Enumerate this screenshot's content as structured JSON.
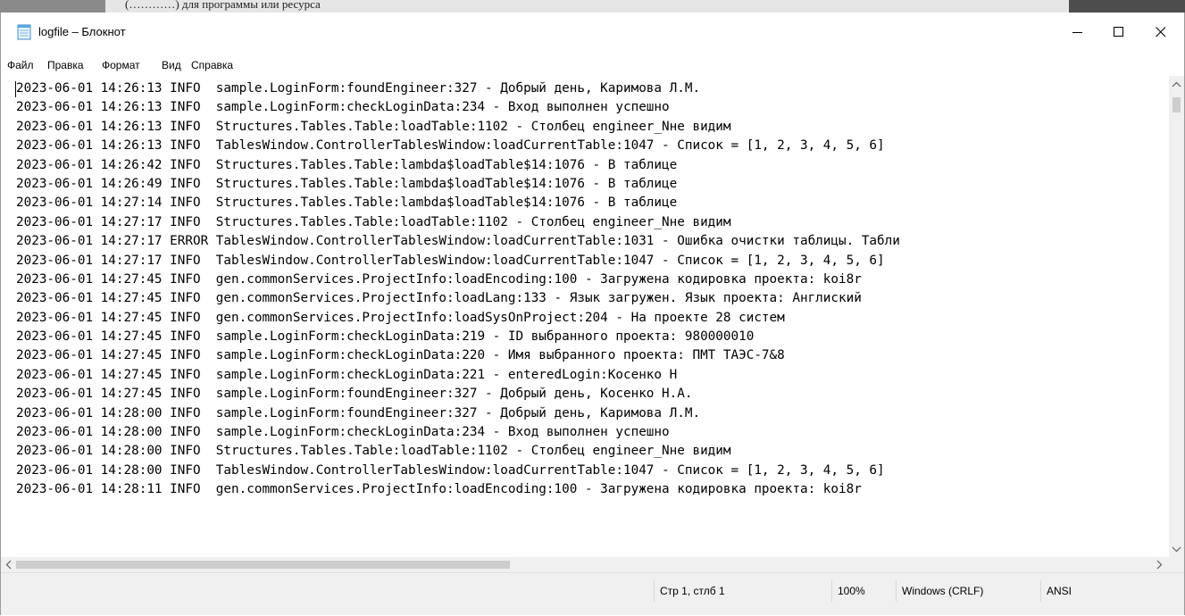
{
  "backdrop": {
    "text": "(…………) для программы или ресурса"
  },
  "window": {
    "title": "logfile – Блокнот",
    "buttons": {
      "minimize": "minimize",
      "maximize": "maximize",
      "close": "close"
    }
  },
  "menu": {
    "items": [
      "Файл",
      "Правка",
      "Формат",
      "Вид",
      "Справка"
    ]
  },
  "editor": {
    "lines": [
      "2023-06-01 14:26:13 INFO  sample.LoginForm:foundEngineer:327 - Добрый день, Каримова Л.М.",
      "2023-06-01 14:26:13 INFO  sample.LoginForm:checkLoginData:234 - Вход выполнен успешно",
      "2023-06-01 14:26:13 INFO  Structures.Tables.Table:loadTable:1102 - Столбец engineer_Nне видим",
      "2023-06-01 14:26:13 INFO  TablesWindow.ControllerTablesWindow:loadCurrentTable:1047 - Список = [1, 2, 3, 4, 5, 6]",
      "2023-06-01 14:26:42 INFO  Structures.Tables.Table:lambda$loadTable$14:1076 - В таблице",
      "2023-06-01 14:26:49 INFO  Structures.Tables.Table:lambda$loadTable$14:1076 - В таблице",
      "2023-06-01 14:27:14 INFO  Structures.Tables.Table:lambda$loadTable$14:1076 - В таблице",
      "2023-06-01 14:27:17 INFO  Structures.Tables.Table:loadTable:1102 - Столбец engineer_Nне видим",
      "2023-06-01 14:27:17 ERROR TablesWindow.ControllerTablesWindow:loadCurrentTable:1031 - Ошибка очистки таблицы. Табли",
      "2023-06-01 14:27:17 INFO  TablesWindow.ControllerTablesWindow:loadCurrentTable:1047 - Список = [1, 2, 3, 4, 5, 6]",
      "2023-06-01 14:27:45 INFO  gen.commonServices.ProjectInfo:loadEncoding:100 - Загружена кодировка проекта: koi8r",
      "2023-06-01 14:27:45 INFO  gen.commonServices.ProjectInfo:loadLang:133 - Язык загружен. Язык проекта: Англиский",
      "2023-06-01 14:27:45 INFO  gen.commonServices.ProjectInfo:loadSysOnProject:204 - На проекте 28 систем",
      "2023-06-01 14:27:45 INFO  sample.LoginForm:checkLoginData:219 - ID выбранного проекта: 980000010",
      "2023-06-01 14:27:45 INFO  sample.LoginForm:checkLoginData:220 - Имя выбранного проекта: ПМТ ТАЭС-7&8",
      "2023-06-01 14:27:45 INFO  sample.LoginForm:checkLoginData:221 - enteredLogin:Косенко Н",
      "2023-06-01 14:27:45 INFO  sample.LoginForm:foundEngineer:327 - Добрый день, Косенко Н.А.",
      "2023-06-01 14:28:00 INFO  sample.LoginForm:foundEngineer:327 - Добрый день, Каримова Л.М.",
      "2023-06-01 14:28:00 INFO  sample.LoginForm:checkLoginData:234 - Вход выполнен успешно",
      "2023-06-01 14:28:00 INFO  Structures.Tables.Table:loadTable:1102 - Столбец engineer_Nне видим",
      "2023-06-01 14:28:00 INFO  TablesWindow.ControllerTablesWindow:loadCurrentTable:1047 - Список = [1, 2, 3, 4, 5, 6]",
      "2023-06-01 14:28:11 INFO  gen.commonServices.ProjectInfo:loadEncoding:100 - Загружена кодировка проекта: koi8r"
    ]
  },
  "status": {
    "position": "Стр 1, стлб 1",
    "zoom": "100%",
    "line_endings": "Windows (CRLF)",
    "encoding": "ANSI"
  }
}
